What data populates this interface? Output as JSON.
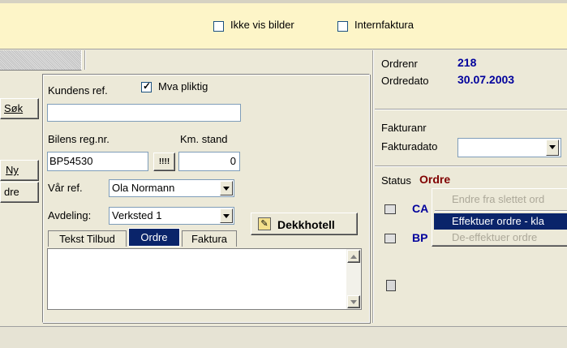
{
  "topbar": {
    "no_images_label": "Ikke vis bilder",
    "internal_invoice_label": "Internfaktura"
  },
  "left_buttons": {
    "search": "Søk",
    "new": "Ny",
    "order_partial": "dre"
  },
  "form": {
    "customer_ref_label": "Kundens ref.",
    "vat_label": "Mva pliktig",
    "customer_ref_value": "",
    "reg_no_label": "Bilens reg.nr.",
    "km_label": "Km. stand",
    "reg_no_value": "BP54530",
    "barcode_glyph": "!!!!",
    "km_value": "0",
    "our_ref_label": "Vår ref.",
    "our_ref_value": "Ola Normann",
    "department_label": "Avdeling:",
    "department_value": "Verksted 1",
    "tire_hotel_button": "Dekkhotell",
    "tabs": [
      "Tekst Tilbud",
      "Ordre",
      "Faktura"
    ],
    "active_tab": "Ordre",
    "notes_value": ""
  },
  "right_panel": {
    "order_no_label": "Ordrenr",
    "order_no_value": "218",
    "order_date_label": "Ordredato",
    "order_date_value": "30.07.2003",
    "invoice_no_label": "Fakturanr",
    "invoice_date_label": "Fakturadato",
    "invoice_date_value": "",
    "status_label": "Status",
    "status_value": "Ordre",
    "link1": "CA",
    "link2": "BP"
  },
  "context_menu": {
    "items": [
      {
        "label": "Endre fra slettet ord",
        "enabled": false
      },
      {
        "label": "Effektuer ordre - kla",
        "enabled": true,
        "highlighted": true
      },
      {
        "label": "De-effektuer ordre",
        "enabled": false
      }
    ]
  },
  "colors": {
    "accent_blue": "#0a246a",
    "status_red": "#800000",
    "value_blue": "#00009c"
  }
}
